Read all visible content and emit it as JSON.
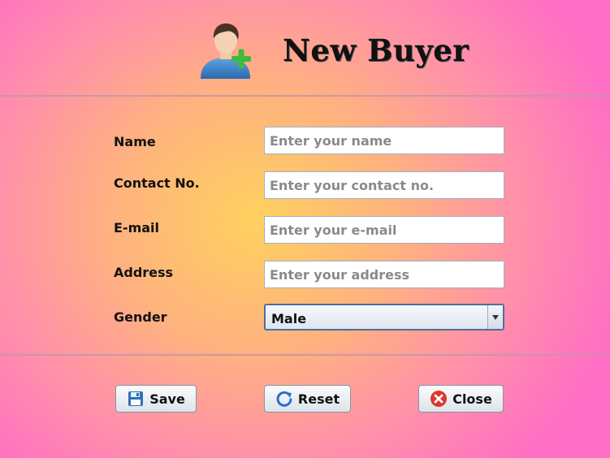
{
  "header": {
    "title": "New Buyer",
    "logo_icon": "add-user-icon"
  },
  "form": {
    "fields": [
      {
        "label": "Name",
        "placeholder": "Enter your name"
      },
      {
        "label": "Contact No.",
        "placeholder": "Enter your contact no."
      },
      {
        "label": "E-mail",
        "placeholder": "Enter your e-mail"
      },
      {
        "label": "Address",
        "placeholder": "Enter your address"
      }
    ],
    "gender": {
      "label": "Gender",
      "selected": "Male"
    }
  },
  "buttons": {
    "save": {
      "label": "Save",
      "icon": "floppy-disk-icon"
    },
    "reset": {
      "label": "Reset",
      "icon": "refresh-icon"
    },
    "close": {
      "label": "Close",
      "icon": "close-icon"
    }
  },
  "colors": {
    "background_center": "#ffd15e",
    "background_edge": "#ff6ec4",
    "separator": "#be96af",
    "reset_icon": "#2a6fd0",
    "close_icon": "#e0352b",
    "save_icon": "#2f6fb5"
  }
}
